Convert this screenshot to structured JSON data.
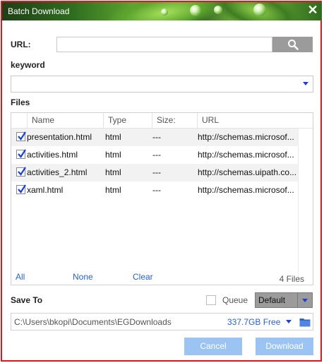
{
  "window": {
    "title": "Batch Download",
    "close_glyph": "✕"
  },
  "form": {
    "url_label": "URL:",
    "url_value": "",
    "keyword_label": "keyword",
    "keyword_value": ""
  },
  "files": {
    "section_label": "Files",
    "columns": [
      "Name",
      "Type",
      "Size:",
      "URL"
    ],
    "rows": [
      {
        "checked": true,
        "name": "presentation.html",
        "type": "html",
        "size": "---",
        "url": "http://schemas.microsof..."
      },
      {
        "checked": true,
        "name": "activities.html",
        "type": "html",
        "size": "---",
        "url": "http://schemas.microsof..."
      },
      {
        "checked": true,
        "name": "activities_2.html",
        "type": "html",
        "size": "---",
        "url": "http://schemas.uipath.co..."
      },
      {
        "checked": true,
        "name": "xaml.html",
        "type": "html",
        "size": "---",
        "url": "http://schemas.microsof..."
      }
    ],
    "footer": {
      "all": "All",
      "none": "None",
      "clear": "Clear",
      "count": "4 Files"
    }
  },
  "save": {
    "label": "Save To",
    "queue_label": "Queue",
    "queue_checked": false,
    "profile_value": "Default",
    "path": "C:\\Users\\bkopi\\Documents\\EGDownloads",
    "free_space": "337.7GB Free"
  },
  "buttons": {
    "cancel": "Cancel",
    "download": "Download"
  },
  "icons": {
    "search": "search-icon",
    "dropdown": "chevron-down-icon",
    "folder": "folder-icon",
    "close": "close-icon",
    "check": "check-icon"
  },
  "colors": {
    "accent_blue": "#1d40d8",
    "link_blue": "#2b63c9",
    "button_blue": "#9cc4f2",
    "border_red": "#d9191f",
    "neutral_gray": "#9b9b9b"
  }
}
